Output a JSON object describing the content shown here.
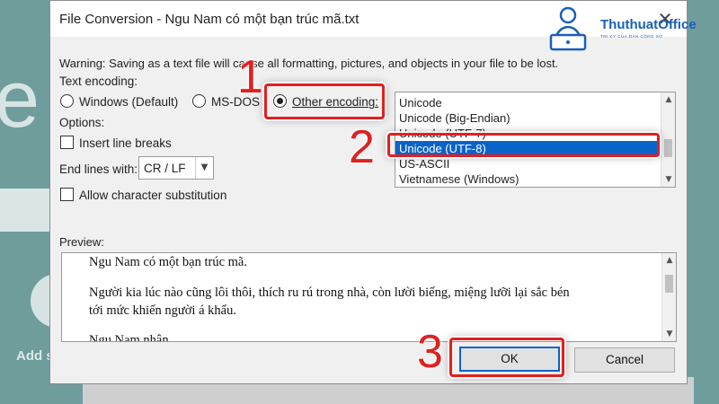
{
  "background": {
    "big_letter": "e",
    "add_text": "Add s"
  },
  "dialog": {
    "title": "File Conversion - Ngu Nam có một bạn trúc mã.txt",
    "warning": "Warning: Saving as a text file will cause all formatting, pictures, and objects in your file to be lost.",
    "text_encoding_label": "Text encoding:",
    "radios": [
      {
        "label": "Windows (Default)",
        "checked": false
      },
      {
        "label": "MS-DOS",
        "checked": false
      },
      {
        "label": "Other encoding:",
        "checked": true
      }
    ],
    "options_label": "Options:",
    "insert_line_breaks": "Insert line breaks",
    "end_lines_label": "End lines with:",
    "end_lines_value": "CR / LF",
    "allow_substitution": "Allow character substitution",
    "encodings": [
      "Unicode",
      "Unicode (Big-Endian)",
      "Unicode (UTF-7)",
      "Unicode (UTF-8)",
      "US-ASCII",
      "Vietnamese (Windows)"
    ],
    "selected_encoding": "Unicode (UTF-8)",
    "preview_label": "Preview:",
    "preview_lines": [
      "Ngu Nam có một bạn trúc mã.",
      "Người kia lúc nào cũng lôi thôi, thích ru rú trong nhà, còn lười biếng, miệng lưỡi lại sắc bén",
      "tới mức khiến người á khẩu.",
      "Ngu Nam nhận ..."
    ],
    "ok_label": "OK",
    "cancel_label": "Cancel"
  },
  "annotations": {
    "step1": "1",
    "step2": "2",
    "step3": "3",
    "highlight_color": "#e02020"
  },
  "logo": {
    "brand": "ThuthuatOffice",
    "tagline": "TRÍ KỲ CỦA DÂN CÔNG SỞ"
  }
}
